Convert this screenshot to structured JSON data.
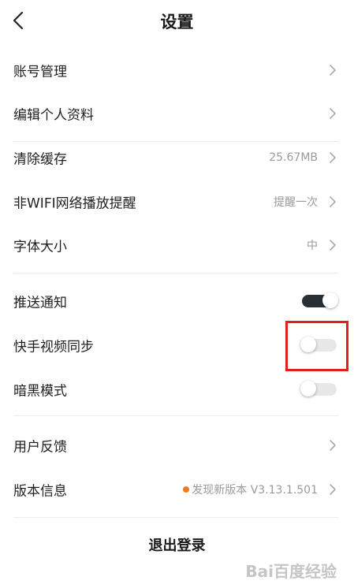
{
  "header": {
    "title": "设置"
  },
  "settings": {
    "account": {
      "label": "账号管理"
    },
    "edit_profile": {
      "label": "编辑个人资料"
    },
    "clear_cache": {
      "label": "清除缓存",
      "value": "25.67MB"
    },
    "non_wifi": {
      "label": "非WIFI网络播放提醒",
      "value": "提醒一次"
    },
    "font_size": {
      "label": "字体大小",
      "value": "中"
    },
    "push": {
      "label": "推送通知",
      "enabled": true
    },
    "kuaishou_sync": {
      "label": "快手视频同步",
      "enabled": false
    },
    "dark_mode": {
      "label": "暗黑模式",
      "enabled": false
    },
    "feedback": {
      "label": "用户反馈"
    },
    "version": {
      "label": "版本信息",
      "value": "发现新版本 V3.13.1.501",
      "dot_color": "#f07a1d"
    }
  },
  "logout": {
    "label": "退出登录"
  },
  "watermark": {
    "text": "Bai百度经验"
  },
  "colors": {
    "toggle_on": "#2a2f36",
    "toggle_off": "#e7e7e7",
    "highlight": "#e02020",
    "notice_dot": "#f07a1d"
  },
  "icons": {
    "back": "chevron-left-icon",
    "row_arrow": "chevron-right-icon"
  }
}
